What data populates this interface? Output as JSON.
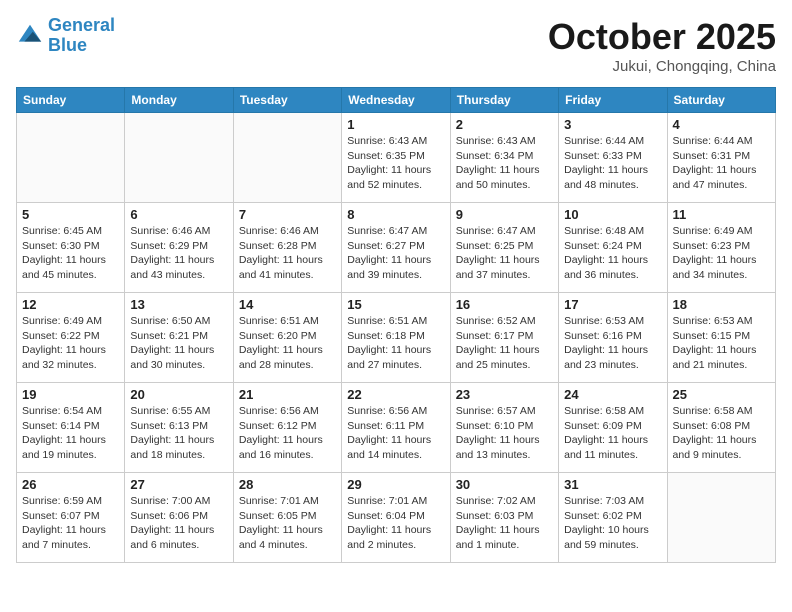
{
  "logo": {
    "line1": "General",
    "line2": "Blue"
  },
  "title": "October 2025",
  "location": "Jukui, Chongqing, China",
  "weekdays": [
    "Sunday",
    "Monday",
    "Tuesday",
    "Wednesday",
    "Thursday",
    "Friday",
    "Saturday"
  ],
  "weeks": [
    [
      {
        "day": "",
        "info": ""
      },
      {
        "day": "",
        "info": ""
      },
      {
        "day": "",
        "info": ""
      },
      {
        "day": "1",
        "info": "Sunrise: 6:43 AM\nSunset: 6:35 PM\nDaylight: 11 hours\nand 52 minutes."
      },
      {
        "day": "2",
        "info": "Sunrise: 6:43 AM\nSunset: 6:34 PM\nDaylight: 11 hours\nand 50 minutes."
      },
      {
        "day": "3",
        "info": "Sunrise: 6:44 AM\nSunset: 6:33 PM\nDaylight: 11 hours\nand 48 minutes."
      },
      {
        "day": "4",
        "info": "Sunrise: 6:44 AM\nSunset: 6:31 PM\nDaylight: 11 hours\nand 47 minutes."
      }
    ],
    [
      {
        "day": "5",
        "info": "Sunrise: 6:45 AM\nSunset: 6:30 PM\nDaylight: 11 hours\nand 45 minutes."
      },
      {
        "day": "6",
        "info": "Sunrise: 6:46 AM\nSunset: 6:29 PM\nDaylight: 11 hours\nand 43 minutes."
      },
      {
        "day": "7",
        "info": "Sunrise: 6:46 AM\nSunset: 6:28 PM\nDaylight: 11 hours\nand 41 minutes."
      },
      {
        "day": "8",
        "info": "Sunrise: 6:47 AM\nSunset: 6:27 PM\nDaylight: 11 hours\nand 39 minutes."
      },
      {
        "day": "9",
        "info": "Sunrise: 6:47 AM\nSunset: 6:25 PM\nDaylight: 11 hours\nand 37 minutes."
      },
      {
        "day": "10",
        "info": "Sunrise: 6:48 AM\nSunset: 6:24 PM\nDaylight: 11 hours\nand 36 minutes."
      },
      {
        "day": "11",
        "info": "Sunrise: 6:49 AM\nSunset: 6:23 PM\nDaylight: 11 hours\nand 34 minutes."
      }
    ],
    [
      {
        "day": "12",
        "info": "Sunrise: 6:49 AM\nSunset: 6:22 PM\nDaylight: 11 hours\nand 32 minutes."
      },
      {
        "day": "13",
        "info": "Sunrise: 6:50 AM\nSunset: 6:21 PM\nDaylight: 11 hours\nand 30 minutes."
      },
      {
        "day": "14",
        "info": "Sunrise: 6:51 AM\nSunset: 6:20 PM\nDaylight: 11 hours\nand 28 minutes."
      },
      {
        "day": "15",
        "info": "Sunrise: 6:51 AM\nSunset: 6:18 PM\nDaylight: 11 hours\nand 27 minutes."
      },
      {
        "day": "16",
        "info": "Sunrise: 6:52 AM\nSunset: 6:17 PM\nDaylight: 11 hours\nand 25 minutes."
      },
      {
        "day": "17",
        "info": "Sunrise: 6:53 AM\nSunset: 6:16 PM\nDaylight: 11 hours\nand 23 minutes."
      },
      {
        "day": "18",
        "info": "Sunrise: 6:53 AM\nSunset: 6:15 PM\nDaylight: 11 hours\nand 21 minutes."
      }
    ],
    [
      {
        "day": "19",
        "info": "Sunrise: 6:54 AM\nSunset: 6:14 PM\nDaylight: 11 hours\nand 19 minutes."
      },
      {
        "day": "20",
        "info": "Sunrise: 6:55 AM\nSunset: 6:13 PM\nDaylight: 11 hours\nand 18 minutes."
      },
      {
        "day": "21",
        "info": "Sunrise: 6:56 AM\nSunset: 6:12 PM\nDaylight: 11 hours\nand 16 minutes."
      },
      {
        "day": "22",
        "info": "Sunrise: 6:56 AM\nSunset: 6:11 PM\nDaylight: 11 hours\nand 14 minutes."
      },
      {
        "day": "23",
        "info": "Sunrise: 6:57 AM\nSunset: 6:10 PM\nDaylight: 11 hours\nand 13 minutes."
      },
      {
        "day": "24",
        "info": "Sunrise: 6:58 AM\nSunset: 6:09 PM\nDaylight: 11 hours\nand 11 minutes."
      },
      {
        "day": "25",
        "info": "Sunrise: 6:58 AM\nSunset: 6:08 PM\nDaylight: 11 hours\nand 9 minutes."
      }
    ],
    [
      {
        "day": "26",
        "info": "Sunrise: 6:59 AM\nSunset: 6:07 PM\nDaylight: 11 hours\nand 7 minutes."
      },
      {
        "day": "27",
        "info": "Sunrise: 7:00 AM\nSunset: 6:06 PM\nDaylight: 11 hours\nand 6 minutes."
      },
      {
        "day": "28",
        "info": "Sunrise: 7:01 AM\nSunset: 6:05 PM\nDaylight: 11 hours\nand 4 minutes."
      },
      {
        "day": "29",
        "info": "Sunrise: 7:01 AM\nSunset: 6:04 PM\nDaylight: 11 hours\nand 2 minutes."
      },
      {
        "day": "30",
        "info": "Sunrise: 7:02 AM\nSunset: 6:03 PM\nDaylight: 11 hours\nand 1 minute."
      },
      {
        "day": "31",
        "info": "Sunrise: 7:03 AM\nSunset: 6:02 PM\nDaylight: 10 hours\nand 59 minutes."
      },
      {
        "day": "",
        "info": ""
      }
    ]
  ]
}
